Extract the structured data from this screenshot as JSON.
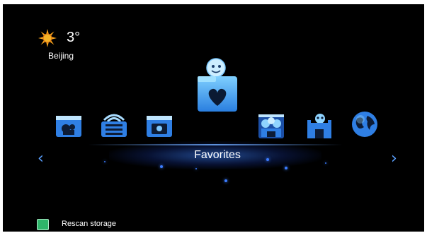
{
  "weather": {
    "temperature": "3°",
    "city": "Beijing",
    "icon": "sun-icon"
  },
  "carousel": {
    "selected_label": "Favorites",
    "apps": [
      {
        "name": "video-folder-icon"
      },
      {
        "name": "wifi-folder-icon"
      },
      {
        "name": "photo-folder-icon"
      },
      {
        "name": "favorites-folder-icon"
      },
      {
        "name": "gallery-icon"
      },
      {
        "name": "game-castle-icon"
      },
      {
        "name": "globe-icon"
      }
    ],
    "prev_arrow": "‹",
    "next_arrow": "›"
  },
  "footer": {
    "action_label": "Rescan storage",
    "key_color": "#2fb56a"
  },
  "colors": {
    "background": "#000000",
    "accent": "#3c7cff"
  }
}
